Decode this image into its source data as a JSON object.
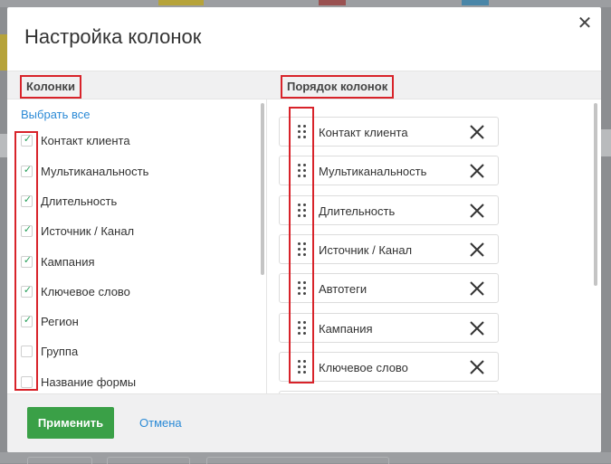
{
  "modal": {
    "title": "Настройка колонок",
    "close_label": "✕"
  },
  "left_panel": {
    "header": "Колонки",
    "select_all": "Выбрать все",
    "items": [
      {
        "label": "Контакт клиента",
        "checked": true
      },
      {
        "label": "Мультиканальность",
        "checked": true
      },
      {
        "label": "Длительность",
        "checked": true
      },
      {
        "label": "Источник / Канал",
        "checked": true
      },
      {
        "label": "Кампания",
        "checked": true
      },
      {
        "label": "Ключевое слово",
        "checked": true
      },
      {
        "label": "Регион",
        "checked": true
      },
      {
        "label": "Группа",
        "checked": false
      },
      {
        "label": "Название формы",
        "checked": false
      }
    ]
  },
  "right_panel": {
    "header": "Порядок колонок",
    "items": [
      {
        "label": "Контакт клиента"
      },
      {
        "label": "Мультиканальность"
      },
      {
        "label": "Длительность"
      },
      {
        "label": "Источник / Канал"
      },
      {
        "label": "Автотеги"
      },
      {
        "label": "Кампания"
      },
      {
        "label": "Ключевое слово"
      }
    ]
  },
  "footer": {
    "apply_label": "Применить",
    "cancel_label": "Отмена"
  },
  "colors": {
    "accent": "#2b8ad6",
    "apply": "#3aa047",
    "highlight": "#d8232a",
    "check": "#2aa05b"
  },
  "icons": {
    "close": "close-icon",
    "check": "check-icon",
    "drag": "drag-handle-icon",
    "remove": "remove-icon"
  }
}
